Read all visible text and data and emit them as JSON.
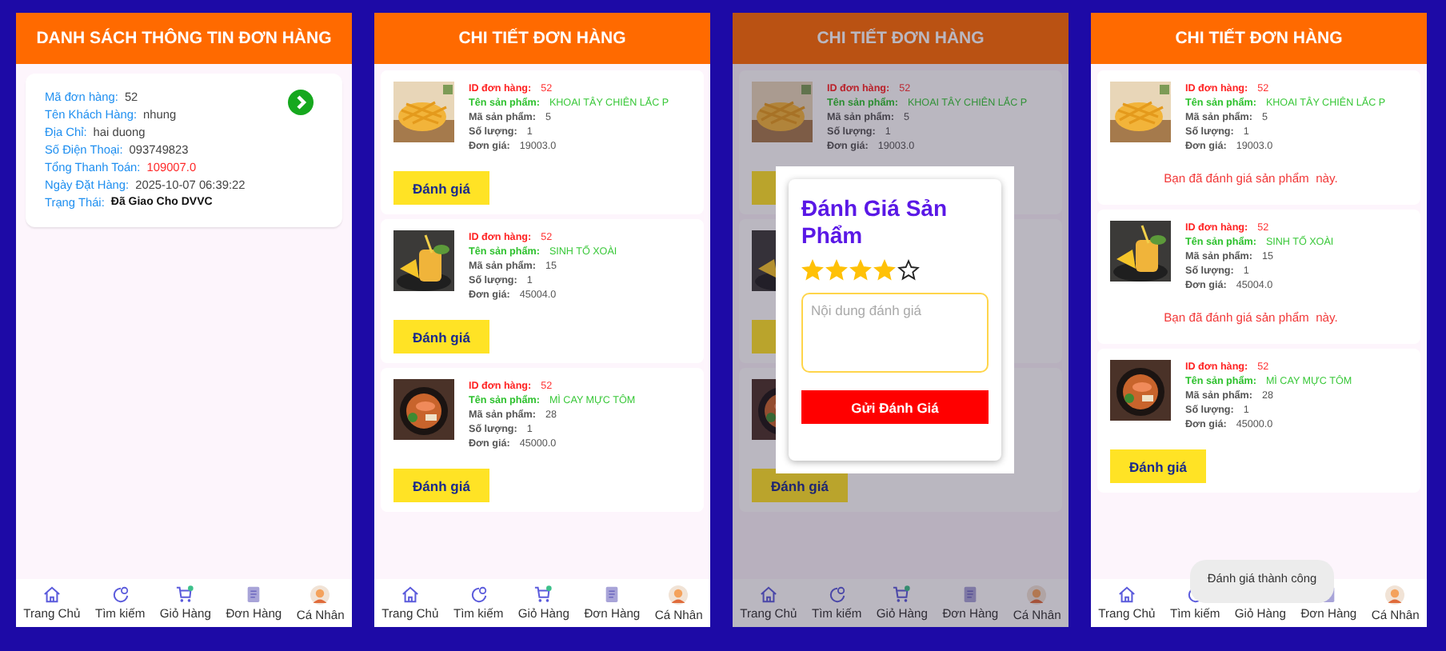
{
  "screens": [
    {
      "kind": "order_list",
      "header": "DANH SÁCH THÔNG TIN ĐƠN HÀNG",
      "orders": [
        {
          "fields": [
            {
              "label": "Mã đơn hàng:",
              "value": "52",
              "kind": "plain"
            },
            {
              "label": "Tên Khách Hàng:",
              "value": "nhung",
              "kind": "plain"
            },
            {
              "label": "Địa Chỉ:",
              "value": "hai duong",
              "kind": "plain"
            },
            {
              "label": "Số Điện Thoại:",
              "value": "093749823",
              "kind": "plain"
            },
            {
              "label": "Tổng Thanh Toán:",
              "value": "109007.0",
              "kind": "price"
            },
            {
              "label": "Ngày Đặt Hàng:",
              "value": "2025-10-07 06:39:22",
              "kind": "plain"
            },
            {
              "label": "Trạng Thái:",
              "value": "Đã Giao Cho DVVC",
              "kind": "status"
            }
          ]
        }
      ],
      "nav": [
        "Trang Chủ",
        "Tìm kiếm",
        "Giỏ Hàng",
        "Đơn Hàng",
        "Cá Nhân"
      ]
    },
    {
      "kind": "order_detail",
      "header": "CHI TIẾT ĐƠN HÀNG",
      "items": [
        {
          "fields": [
            {
              "label": "ID đơn hàng:",
              "value": "52",
              "kind": "id"
            },
            {
              "label": "Tên sản phẩm:",
              "value": "KHOAI TÂY CHIÊN LẮC P",
              "kind": "name"
            },
            {
              "label": "Mã sản phẩm:",
              "value": "5",
              "kind": "plain"
            },
            {
              "label": "Số lượng:",
              "value": "1",
              "kind": "plain"
            },
            {
              "label": "Đơn giá:",
              "value": "19003.0",
              "kind": "plain"
            }
          ],
          "action": {
            "kind": "button",
            "label": "Đánh giá"
          }
        },
        {
          "fields": [
            {
              "label": "ID đơn hàng:",
              "value": "52",
              "kind": "id"
            },
            {
              "label": "Tên sản phẩm:",
              "value": "SINH TỐ XOÀI",
              "kind": "name"
            },
            {
              "label": "Mã sản phẩm:",
              "value": "15",
              "kind": "plain"
            },
            {
              "label": "Số lượng:",
              "value": "1",
              "kind": "plain"
            },
            {
              "label": "Đơn giá:",
              "value": "45004.0",
              "kind": "plain"
            }
          ],
          "action": {
            "kind": "button",
            "label": "Đánh giá"
          }
        },
        {
          "fields": [
            {
              "label": "ID đơn hàng:",
              "value": "52",
              "kind": "id"
            },
            {
              "label": "Tên sản phẩm:",
              "value": "MÌ CAY MỰC TÔM",
              "kind": "name"
            },
            {
              "label": "Mã sản phẩm:",
              "value": "28",
              "kind": "plain"
            },
            {
              "label": "Số lượng:",
              "value": "1",
              "kind": "plain"
            },
            {
              "label": "Đơn giá:",
              "value": "45000.0",
              "kind": "plain"
            }
          ],
          "action": {
            "kind": "button",
            "label": "Đánh giá"
          }
        }
      ],
      "nav": [
        "Trang Chủ",
        "Tìm kiếm",
        "Giỏ Hàng",
        "Đơn Hàng",
        "Cá Nhân"
      ]
    },
    {
      "kind": "order_detail",
      "header": "CHI TIẾT ĐƠN HÀNG",
      "dimmed": true,
      "items": [
        {
          "fields": [
            {
              "label": "ID đơn hàng:",
              "value": "52",
              "kind": "id"
            },
            {
              "label": "Tên sản phẩm:",
              "value": "KHOAI TÂY CHIÊN LẮC P",
              "kind": "name"
            },
            {
              "label": "Mã sản phẩm:",
              "value": "5",
              "kind": "plain"
            },
            {
              "label": "Số lượng:",
              "value": "1",
              "kind": "plain"
            },
            {
              "label": "Đơn giá:",
              "value": "19003.0",
              "kind": "plain"
            }
          ],
          "action": {
            "kind": "button"
          }
        },
        {
          "action": {
            "kind": "button"
          }
        },
        {
          "action": {
            "kind": "button",
            "label": "Đánh giá"
          }
        }
      ],
      "dialog": {
        "title": "Đánh Giá Sản Phẩm",
        "stars": 4,
        "placeholder": "Nội dung đánh giá",
        "submit": "Gửi Đánh Giá"
      },
      "nav": [
        "Trang Chủ",
        "Tìm kiếm",
        "Giỏ Hàng",
        "Đơn Hàng",
        "Cá Nhân"
      ]
    },
    {
      "kind": "order_detail",
      "header": "CHI TIẾT ĐƠN HÀNG",
      "items": [
        {
          "fields": [
            {
              "label": "ID đơn hàng:",
              "value": "52",
              "kind": "id"
            },
            {
              "label": "Tên sản phẩm:",
              "value": "KHOAI TÂY CHIÊN LẮC P",
              "kind": "name"
            },
            {
              "label": "Mã sản phẩm:",
              "value": "5",
              "kind": "plain"
            },
            {
              "label": "Số lượng:",
              "value": "1",
              "kind": "plain"
            },
            {
              "label": "Đơn giá:",
              "value": "19003.0",
              "kind": "plain"
            }
          ],
          "action": {
            "kind": "message",
            "text": "Bạn đã đánh giá sản phẩm  này."
          }
        },
        {
          "fields": [
            {
              "label": "ID đơn hàng:",
              "value": "52",
              "kind": "id"
            },
            {
              "label": "Tên sản phẩm:",
              "value": "SINH TỐ XOÀI",
              "kind": "name"
            },
            {
              "label": "Mã sản phẩm:",
              "value": "15",
              "kind": "plain"
            },
            {
              "label": "Số lượng:",
              "value": "1",
              "kind": "plain"
            },
            {
              "label": "Đơn giá:",
              "value": "45004.0",
              "kind": "plain"
            }
          ],
          "action": {
            "kind": "message",
            "text": "Bạn đã đánh giá sản phẩm  này."
          }
        },
        {
          "fields": [
            {
              "label": "ID đơn hàng:",
              "value": "52",
              "kind": "id"
            },
            {
              "label": "Tên sản phẩm:",
              "value": "MÌ CAY MỰC TÔM",
              "kind": "name"
            },
            {
              "label": "Mã sản phẩm:",
              "value": "28",
              "kind": "plain"
            },
            {
              "label": "Số lượng:",
              "value": "1",
              "kind": "plain"
            },
            {
              "label": "Đơn giá:",
              "value": "45000.0",
              "kind": "plain"
            }
          ],
          "action": {
            "kind": "button",
            "label": "Đánh giá"
          }
        }
      ],
      "toast": "Đánh giá thành công",
      "nav": [
        "Trang Chủ",
        "Tìm kiếm",
        "Giỏ Hàng",
        "Đơn Hàng",
        "Cá Nhân"
      ]
    }
  ]
}
